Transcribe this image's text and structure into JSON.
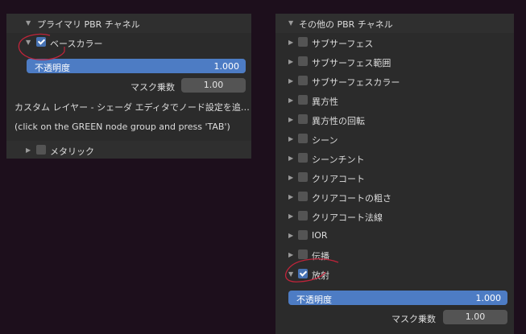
{
  "left_panel": {
    "header": "プライマリ PBR チャネル",
    "base_color": {
      "label": "ベースカラー",
      "checked": true
    },
    "opacity": {
      "label": "不透明度",
      "value": "1.000",
      "fraction": 1.0
    },
    "mask": {
      "label": "マスク乗数",
      "value": "1.00"
    },
    "info_line1": "カスタム レイヤー - シェーダ エディタでノード設定を追…",
    "info_line2": "(click on the GREEN node group and press 'TAB')",
    "metallic": {
      "label": "メタリック",
      "checked": false
    }
  },
  "right_panel": {
    "header": "その他の PBR チャネル",
    "channels": [
      {
        "label": "サブサーフェス",
        "checked": false
      },
      {
        "label": "サブサーフェス範囲",
        "checked": false
      },
      {
        "label": "サブサーフェスカラー",
        "checked": false
      },
      {
        "label": "異方性",
        "checked": false
      },
      {
        "label": "異方性の回転",
        "checked": false
      },
      {
        "label": "シーン",
        "checked": false
      },
      {
        "label": "シーンチント",
        "checked": false
      },
      {
        "label": "クリアコート",
        "checked": false
      },
      {
        "label": "クリアコートの粗さ",
        "checked": false
      },
      {
        "label": "クリアコート法線",
        "checked": false
      },
      {
        "label": "IOR",
        "checked": false
      },
      {
        "label": "伝播",
        "checked": false
      },
      {
        "label": "放射",
        "checked": true
      }
    ],
    "opacity": {
      "label": "不透明度",
      "value": "1.000",
      "fraction": 1.0
    },
    "mask": {
      "label": "マスク乗数",
      "value": "1.00"
    }
  },
  "colors": {
    "accent": "#4d7cc4",
    "annotation": "#c0243a",
    "panel": "#2b2b2b",
    "background": "#1d0f1c"
  }
}
